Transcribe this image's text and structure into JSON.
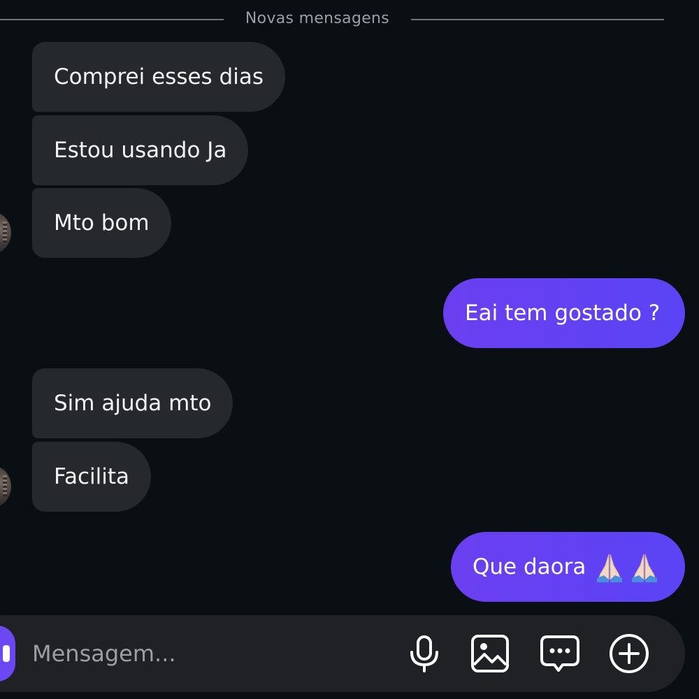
{
  "divider": {
    "label": "Novas mensagens"
  },
  "messages": [
    {
      "direction": "incoming",
      "text": "Comprei esses dias"
    },
    {
      "direction": "incoming",
      "text": "Estou usando Ja"
    },
    {
      "direction": "incoming",
      "text": "Mto bom"
    },
    {
      "direction": "outgoing",
      "text": "Eai tem gostado ?"
    },
    {
      "direction": "incoming",
      "text": "Sim ajuda mto"
    },
    {
      "direction": "incoming",
      "text": "Facilita"
    },
    {
      "direction": "outgoing",
      "text": "Que daora",
      "emoji": "🙏🏻🙏🏻"
    }
  ],
  "composer": {
    "placeholder": "Mensagem...",
    "tools": [
      "microphone-icon",
      "image-icon",
      "chat-bubble-icon",
      "plus-circle-icon"
    ]
  },
  "colors": {
    "background": "#0a0f13",
    "incoming_bubble": "#25282d",
    "outgoing_bubble": "#5b3df4",
    "composer": "#1f2124"
  }
}
